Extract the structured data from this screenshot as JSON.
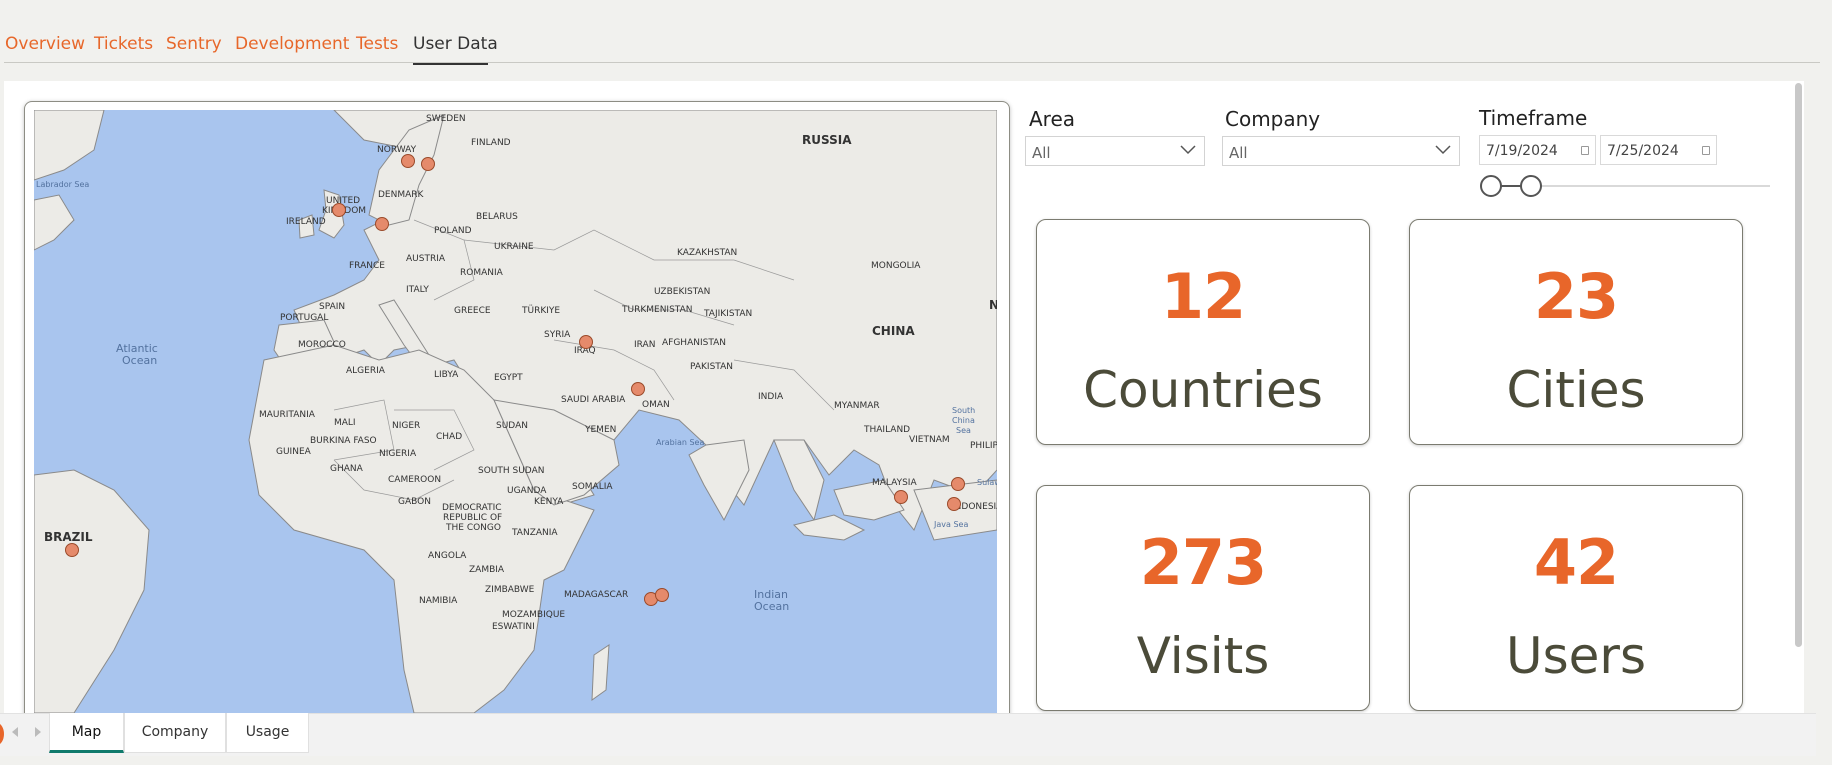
{
  "top_tabs": [
    {
      "label": "Overview"
    },
    {
      "label": "Tickets"
    },
    {
      "label": "Sentry"
    },
    {
      "label": "Development"
    },
    {
      "label": "Tests"
    },
    {
      "label": "User Data"
    }
  ],
  "active_top_tab": "User Data",
  "map": {
    "labels": {
      "sweden": "SWEDEN",
      "finland": "FINLAND",
      "russia": "RUSSIA",
      "norway": "NORWAY",
      "labrador_sea": "Labrador Sea",
      "united_kingdom_1": "UNITED",
      "united_kingdom_2": "KINGDOM",
      "denmark": "DENMARK",
      "ireland": "IRELAND",
      "belarus": "BELARUS",
      "poland": "POLAND",
      "ukraine": "UKRAINE",
      "kazakhstan": "KAZAKHSTAN",
      "mongolia": "MONGOLIA",
      "france": "FRANCE",
      "austria": "AUSTRIA",
      "romania": "ROMANIA",
      "italy": "ITALY",
      "uzbekistan": "UZBEKISTAN",
      "spain": "SPAIN",
      "turkmenistan": "TURKMENISTAN",
      "tajikistan": "TAJIKISTAN",
      "turkiye": "TÜRKIYE",
      "greece": "GREECE",
      "portugal": "PORTUGAL",
      "syria": "SYRIA",
      "china": "CHINA",
      "atlantic_1": "Atlantic",
      "atlantic_2": "Ocean",
      "morocco": "MOROCCO",
      "iraq": "IRAQ",
      "iran": "IRAN",
      "afghanistan": "AFGHANISTAN",
      "pakistan": "PAKISTAN",
      "algeria": "ALGERIA",
      "libya": "LIBYA",
      "egypt": "EGYPT",
      "saudi_arabia": "SAUDI ARABIA",
      "oman": "OMAN",
      "india": "INDIA",
      "myanmar": "MYANMAR",
      "mauritania": "MAURITANIA",
      "mali": "MALI",
      "niger": "NIGER",
      "chad": "CHAD",
      "sudan": "SUDAN",
      "yemen": "YEMEN",
      "thailand": "THAILAND",
      "south_china_1": "South",
      "south_china_2": "China",
      "south_china_3": "Sea",
      "guinea": "GUINEA",
      "burkina_faso": "BURKINA FASO",
      "nigeria": "NIGERIA",
      "vietnam": "VIETNAM",
      "philippines": "PHILIP",
      "arabian_sea": "Arabian Sea",
      "ghana": "GHANA",
      "south_sudan": "SOUTH SUDAN",
      "cameroon": "CAMEROON",
      "somalia": "SOMALIA",
      "malaysia": "MALAYSIA",
      "sulawesi": "Sulaw",
      "uganda": "UGANDA",
      "kenya": "KENYA",
      "gabon": "GABON",
      "indonesia": "INDONESIA",
      "drc_1": "DEMOCRATIC",
      "drc_2": "REPUBLIC OF",
      "drc_3": "THE CONGO",
      "java_sea": "Java Sea",
      "brazil": "BRAZIL",
      "tanzania": "TANZANIA",
      "angola": "ANGOLA",
      "zambia": "ZAMBIA",
      "zimbabwe": "ZIMBABWE",
      "madagascar": "MADAGASCAR",
      "indian_1": "Indian",
      "indian_2": "Ocean",
      "namibia": "NAMIBIA",
      "mozambique": "MOZAMBIQUE",
      "eswatini": "ESWATINI",
      "n_edge": "N"
    }
  },
  "filters": {
    "area": {
      "title": "Area",
      "value": "All"
    },
    "company": {
      "title": "Company",
      "value": "All"
    },
    "timeframe": {
      "title": "Timeframe",
      "start": "7/19/2024",
      "end": "7/25/2024"
    }
  },
  "kpis": [
    {
      "value": "12",
      "label": "Countries"
    },
    {
      "value": "23",
      "label": "Cities"
    },
    {
      "value": "273",
      "label": "Visits"
    },
    {
      "value": "42",
      "label": "Users"
    }
  ],
  "page_tabs": [
    {
      "label": "Map"
    },
    {
      "label": "Company"
    },
    {
      "label": "Usage"
    }
  ],
  "active_page_tab": "Map",
  "colors": {
    "accent": "#e8662a",
    "kpi_label": "#4b4b39",
    "map_water": "#a9c5ee",
    "map_land": "#ecebe7",
    "marker": "#e58a6b",
    "active_tab_underline": "#107a6c"
  }
}
